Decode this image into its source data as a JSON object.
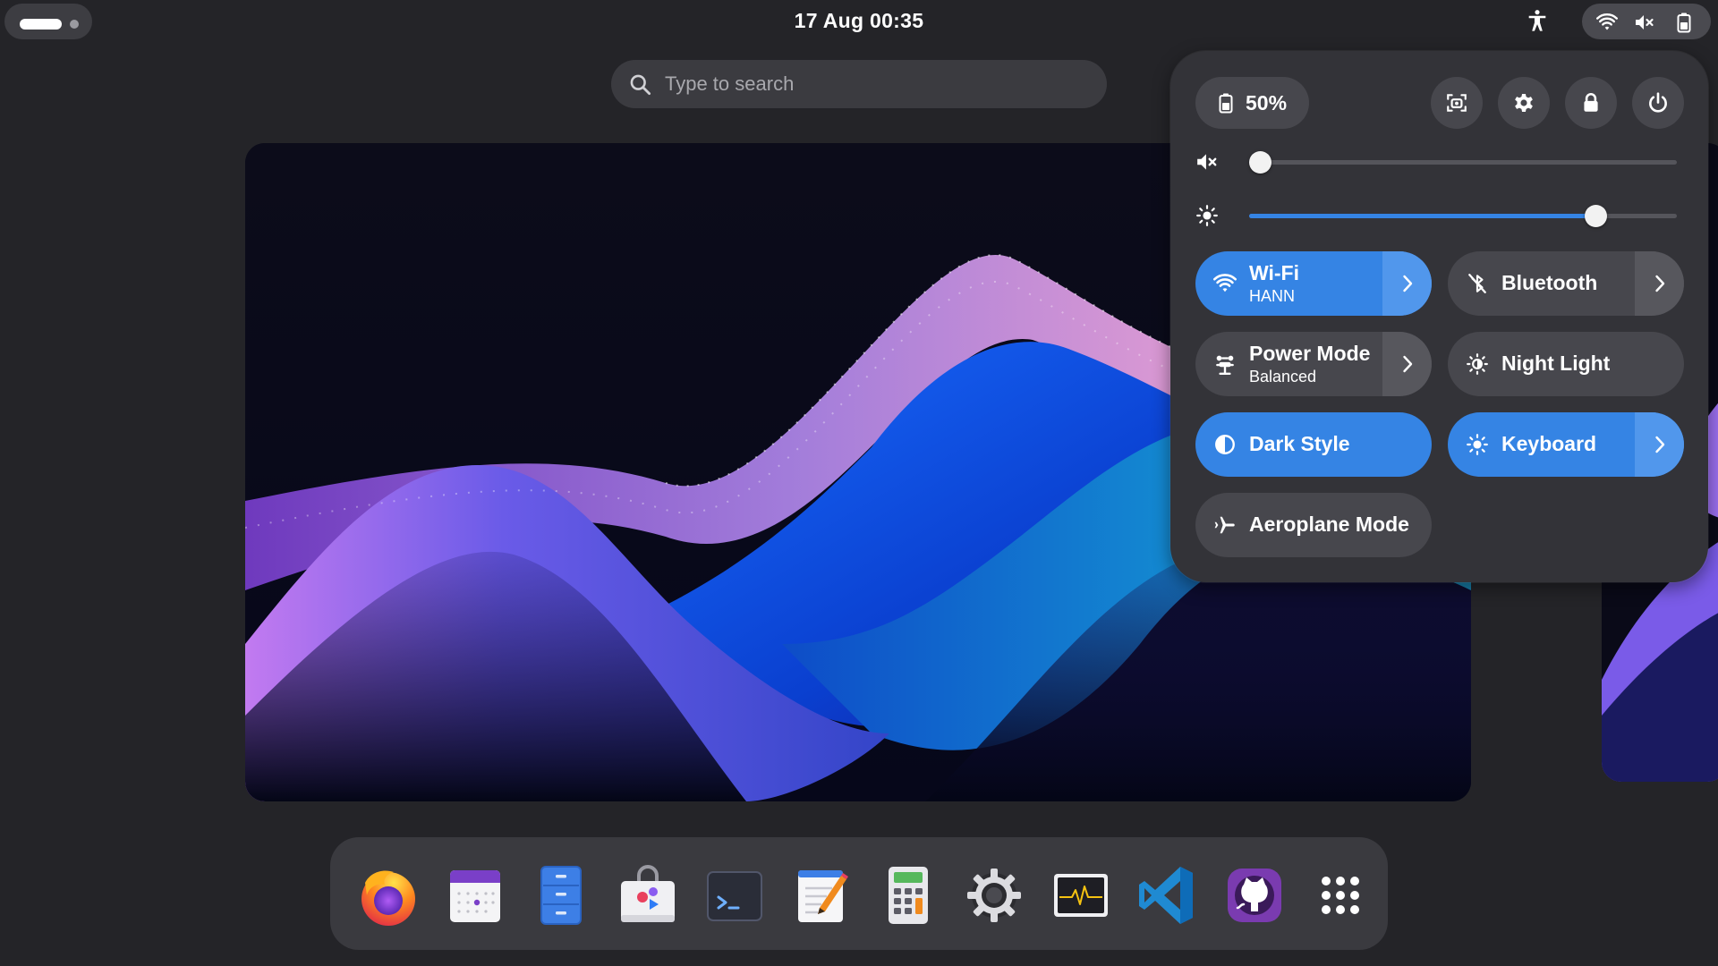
{
  "top_bar": {
    "clock": "17 Aug  00:35",
    "icons": [
      "activities-indicator",
      "accessibility-icon",
      "wifi-icon",
      "volume-muted-icon",
      "battery-icon"
    ]
  },
  "search": {
    "placeholder": "Type to search",
    "value": ""
  },
  "quick_settings": {
    "battery_label": "50%",
    "battery_percent": 50,
    "header_buttons": [
      "screenshot-icon",
      "settings-icon",
      "lock-icon",
      "power-icon"
    ],
    "volume": {
      "icon": "volume-muted-icon",
      "level": 0.0
    },
    "brightness": {
      "icon": "brightness-icon",
      "level": 0.81
    },
    "toggles": [
      {
        "id": "wifi",
        "title": "Wi-Fi",
        "subtitle": "HANN",
        "active": true,
        "has_menu": true,
        "icon": "wifi-icon"
      },
      {
        "id": "bluetooth",
        "title": "Bluetooth",
        "subtitle": "",
        "active": false,
        "has_menu": true,
        "icon": "bluetooth-disabled-icon"
      },
      {
        "id": "power-mode",
        "title": "Power Mode",
        "subtitle": "Balanced",
        "active": false,
        "has_menu": true,
        "icon": "power-mode-icon"
      },
      {
        "id": "night-light",
        "title": "Night Light",
        "subtitle": "",
        "active": false,
        "has_menu": false,
        "icon": "night-light-icon"
      },
      {
        "id": "dark-style",
        "title": "Dark Style",
        "subtitle": "",
        "active": true,
        "has_menu": false,
        "icon": "dark-style-icon"
      },
      {
        "id": "keyboard",
        "title": "Keyboard",
        "subtitle": "",
        "active": true,
        "has_menu": true,
        "icon": "keyboard-brightness-icon"
      },
      {
        "id": "aeroplane-mode",
        "title": "Aeroplane Mode",
        "subtitle": "",
        "active": false,
        "has_menu": false,
        "icon": "aeroplane-icon"
      }
    ]
  },
  "dock": {
    "apps": [
      "firefox-icon",
      "calendar-icon",
      "files-icon",
      "software-icon",
      "terminal-icon",
      "text-editor-icon",
      "calculator-icon",
      "settings-icon",
      "system-monitor-icon",
      "vscode-icon",
      "github-desktop-icon",
      "show-apps-icon"
    ]
  },
  "colors": {
    "accent": "#3584e4",
    "panel": "#333338",
    "background": "#242428",
    "button": "#47474d"
  }
}
